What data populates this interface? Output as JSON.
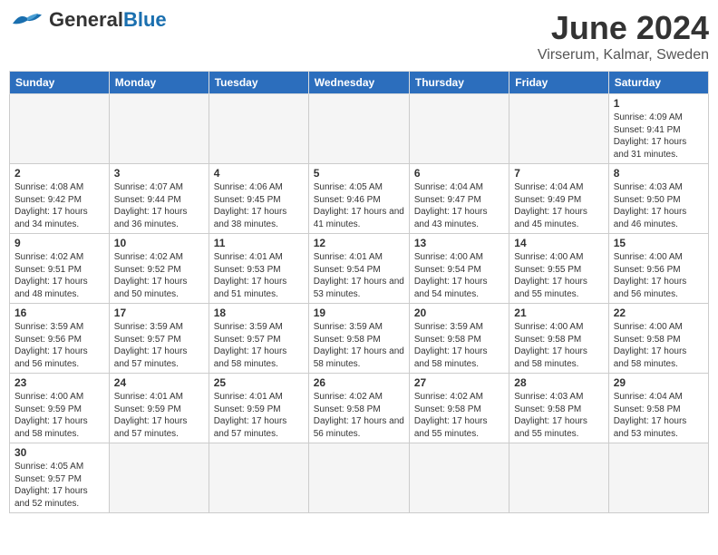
{
  "header": {
    "logo_general": "General",
    "logo_blue": "Blue",
    "month_title": "June 2024",
    "subtitle": "Virserum, Kalmar, Sweden"
  },
  "weekdays": [
    "Sunday",
    "Monday",
    "Tuesday",
    "Wednesday",
    "Thursday",
    "Friday",
    "Saturday"
  ],
  "weeks": [
    [
      null,
      null,
      null,
      null,
      null,
      null,
      {
        "day": "1",
        "sunrise": "4:09 AM",
        "sunset": "9:41 PM",
        "daylight": "17 hours and 31 minutes."
      }
    ],
    [
      {
        "day": "2",
        "sunrise": "4:08 AM",
        "sunset": "9:42 PM",
        "daylight": "17 hours and 34 minutes."
      },
      {
        "day": "3",
        "sunrise": "4:07 AM",
        "sunset": "9:44 PM",
        "daylight": "17 hours and 36 minutes."
      },
      {
        "day": "4",
        "sunrise": "4:06 AM",
        "sunset": "9:45 PM",
        "daylight": "17 hours and 38 minutes."
      },
      {
        "day": "5",
        "sunrise": "4:05 AM",
        "sunset": "9:46 PM",
        "daylight": "17 hours and 41 minutes."
      },
      {
        "day": "6",
        "sunrise": "4:04 AM",
        "sunset": "9:47 PM",
        "daylight": "17 hours and 43 minutes."
      },
      {
        "day": "7",
        "sunrise": "4:04 AM",
        "sunset": "9:49 PM",
        "daylight": "17 hours and 45 minutes."
      },
      {
        "day": "8",
        "sunrise": "4:03 AM",
        "sunset": "9:50 PM",
        "daylight": "17 hours and 46 minutes."
      }
    ],
    [
      {
        "day": "9",
        "sunrise": "4:02 AM",
        "sunset": "9:51 PM",
        "daylight": "17 hours and 48 minutes."
      },
      {
        "day": "10",
        "sunrise": "4:02 AM",
        "sunset": "9:52 PM",
        "daylight": "17 hours and 50 minutes."
      },
      {
        "day": "11",
        "sunrise": "4:01 AM",
        "sunset": "9:53 PM",
        "daylight": "17 hours and 51 minutes."
      },
      {
        "day": "12",
        "sunrise": "4:01 AM",
        "sunset": "9:54 PM",
        "daylight": "17 hours and 53 minutes."
      },
      {
        "day": "13",
        "sunrise": "4:00 AM",
        "sunset": "9:54 PM",
        "daylight": "17 hours and 54 minutes."
      },
      {
        "day": "14",
        "sunrise": "4:00 AM",
        "sunset": "9:55 PM",
        "daylight": "17 hours and 55 minutes."
      },
      {
        "day": "15",
        "sunrise": "4:00 AM",
        "sunset": "9:56 PM",
        "daylight": "17 hours and 56 minutes."
      }
    ],
    [
      {
        "day": "16",
        "sunrise": "3:59 AM",
        "sunset": "9:56 PM",
        "daylight": "17 hours and 56 minutes."
      },
      {
        "day": "17",
        "sunrise": "3:59 AM",
        "sunset": "9:57 PM",
        "daylight": "17 hours and 57 minutes."
      },
      {
        "day": "18",
        "sunrise": "3:59 AM",
        "sunset": "9:57 PM",
        "daylight": "17 hours and 58 minutes."
      },
      {
        "day": "19",
        "sunrise": "3:59 AM",
        "sunset": "9:58 PM",
        "daylight": "17 hours and 58 minutes."
      },
      {
        "day": "20",
        "sunrise": "3:59 AM",
        "sunset": "9:58 PM",
        "daylight": "17 hours and 58 minutes."
      },
      {
        "day": "21",
        "sunrise": "4:00 AM",
        "sunset": "9:58 PM",
        "daylight": "17 hours and 58 minutes."
      },
      {
        "day": "22",
        "sunrise": "4:00 AM",
        "sunset": "9:58 PM",
        "daylight": "17 hours and 58 minutes."
      }
    ],
    [
      {
        "day": "23",
        "sunrise": "4:00 AM",
        "sunset": "9:59 PM",
        "daylight": "17 hours and 58 minutes."
      },
      {
        "day": "24",
        "sunrise": "4:01 AM",
        "sunset": "9:59 PM",
        "daylight": "17 hours and 57 minutes."
      },
      {
        "day": "25",
        "sunrise": "4:01 AM",
        "sunset": "9:59 PM",
        "daylight": "17 hours and 57 minutes."
      },
      {
        "day": "26",
        "sunrise": "4:02 AM",
        "sunset": "9:58 PM",
        "daylight": "17 hours and 56 minutes."
      },
      {
        "day": "27",
        "sunrise": "4:02 AM",
        "sunset": "9:58 PM",
        "daylight": "17 hours and 55 minutes."
      },
      {
        "day": "28",
        "sunrise": "4:03 AM",
        "sunset": "9:58 PM",
        "daylight": "17 hours and 55 minutes."
      },
      {
        "day": "29",
        "sunrise": "4:04 AM",
        "sunset": "9:58 PM",
        "daylight": "17 hours and 53 minutes."
      }
    ],
    [
      {
        "day": "30",
        "sunrise": "4:05 AM",
        "sunset": "9:57 PM",
        "daylight": "17 hours and 52 minutes."
      },
      null,
      null,
      null,
      null,
      null,
      null
    ]
  ]
}
